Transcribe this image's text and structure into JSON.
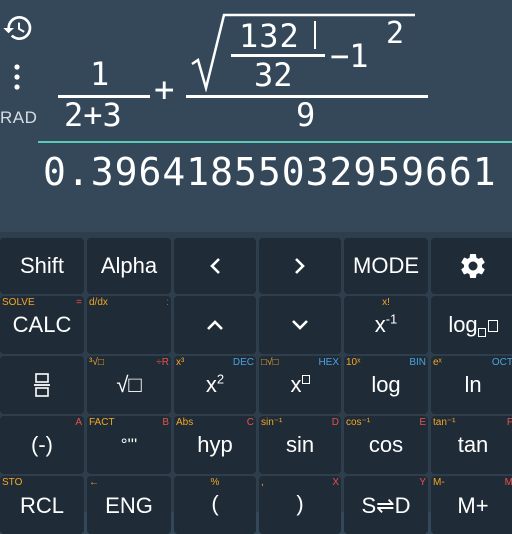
{
  "display": {
    "angle_mode": "RAD",
    "expression": {
      "frac1_num": "1",
      "frac1_den": "2+3",
      "plus": "+",
      "inner_num": "132",
      "inner_den": "32",
      "minus_one": "−1",
      "exponent": "2",
      "outer_den": "9"
    },
    "result": "0.39641855032959661"
  },
  "keys": {
    "row1": {
      "shift": "Shift",
      "alpha": "Alpha",
      "left": "‹",
      "right": "›",
      "mode": "MODE",
      "settings": "gear-icon"
    },
    "row2": {
      "calc": "CALC",
      "calc_shift": "SOLVE",
      "calc_alpha": "=",
      "ddx_shift": "d/dx",
      "ddx_alpha": ":",
      "up": "˄",
      "down": "˅",
      "xinv_shift": "x!",
      "xinv_base": "x",
      "xinv_sup": "-1",
      "log_base": "log"
    },
    "row3": {
      "frac": "⁻⁄₋",
      "frac_shift": "³√□",
      "frac_alpha": "÷R",
      "sqrt": "√□",
      "sqrt_shift": "x³",
      "sqrt_alpha": "DEC",
      "x2_base": "x",
      "x2_sup": "2",
      "x2_shift": "□√□",
      "x2_alpha": "HEX",
      "xpow_base": "x",
      "xpow_shift": "10ˣ",
      "xpow_alpha": "BIN",
      "log": "log",
      "log_shift": "eˣ",
      "log_alpha": "OCT",
      "ln": "ln"
    },
    "row4": {
      "neg": "(-)",
      "neg_shift": "",
      "neg_alpha": "A",
      "dms": "°'''",
      "dms_shift": "FACT",
      "dms_alpha": "B",
      "hyp": "hyp",
      "hyp_shift": "Abs",
      "hyp_alpha": "C",
      "sin": "sin",
      "sin_shift": "sin⁻¹",
      "sin_alpha": "D",
      "cos": "cos",
      "cos_shift": "cos⁻¹",
      "cos_alpha": "E",
      "tan": "tan",
      "tan_shift": "tan⁻¹",
      "tan_alpha": "F"
    },
    "row5": {
      "rcl": "RCL",
      "rcl_shift": "STO",
      "eng": "ENG",
      "eng_shift": "←",
      "lparen": "(",
      "lparen_shift": "%",
      "rparen": ")",
      "rparen_shift": ",",
      "rparen_alpha": "X",
      "sd": "S⇌D",
      "sd_alpha": "Y",
      "mplus": "M+",
      "mplus_shift": "M-",
      "mplus_alpha": "M"
    }
  }
}
